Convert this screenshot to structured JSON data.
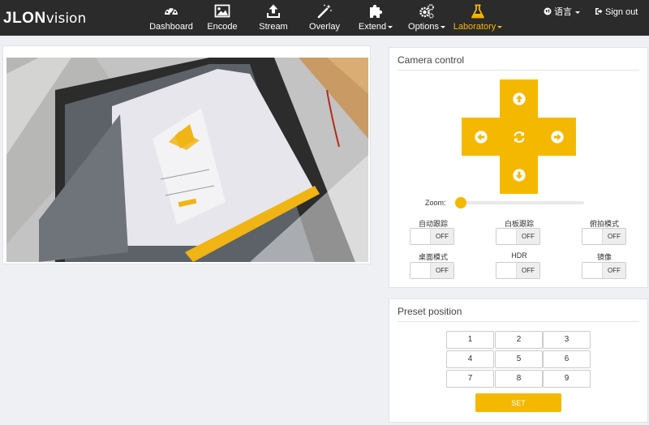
{
  "brand": {
    "part1": "JLON",
    "part2": "vision"
  },
  "nav": {
    "items": [
      {
        "label": "Dashboard"
      },
      {
        "label": "Encode"
      },
      {
        "label": "Stream"
      },
      {
        "label": "Overlay"
      },
      {
        "label": "Extend"
      },
      {
        "label": "Options"
      },
      {
        "label": "Laboratory"
      }
    ],
    "active": "Laboratory",
    "active_color": "#f5b800"
  },
  "header_right": {
    "language": "语言",
    "signout": "Sign out"
  },
  "camera_control": {
    "title": "Camera control",
    "zoom_label": "Zoom:",
    "zoom_level": 0,
    "toggles": [
      {
        "label": "自动跟踪",
        "state": "OFF"
      },
      {
        "label": "白板跟踪",
        "state": "OFF"
      },
      {
        "label": "俯拍模式",
        "state": "OFF"
      },
      {
        "label": "桌面模式",
        "state": "OFF"
      },
      {
        "label": "HDR",
        "state": "OFF"
      },
      {
        "label": "镜像",
        "state": "OFF"
      }
    ]
  },
  "preset": {
    "title": "Preset position",
    "buttons": [
      "1",
      "2",
      "3",
      "4",
      "5",
      "6",
      "7",
      "8",
      "9"
    ],
    "set_label": "SET"
  },
  "colors": {
    "accent": "#f5b800",
    "topbar": "#2b2b2b",
    "background": "#eff0f4"
  }
}
